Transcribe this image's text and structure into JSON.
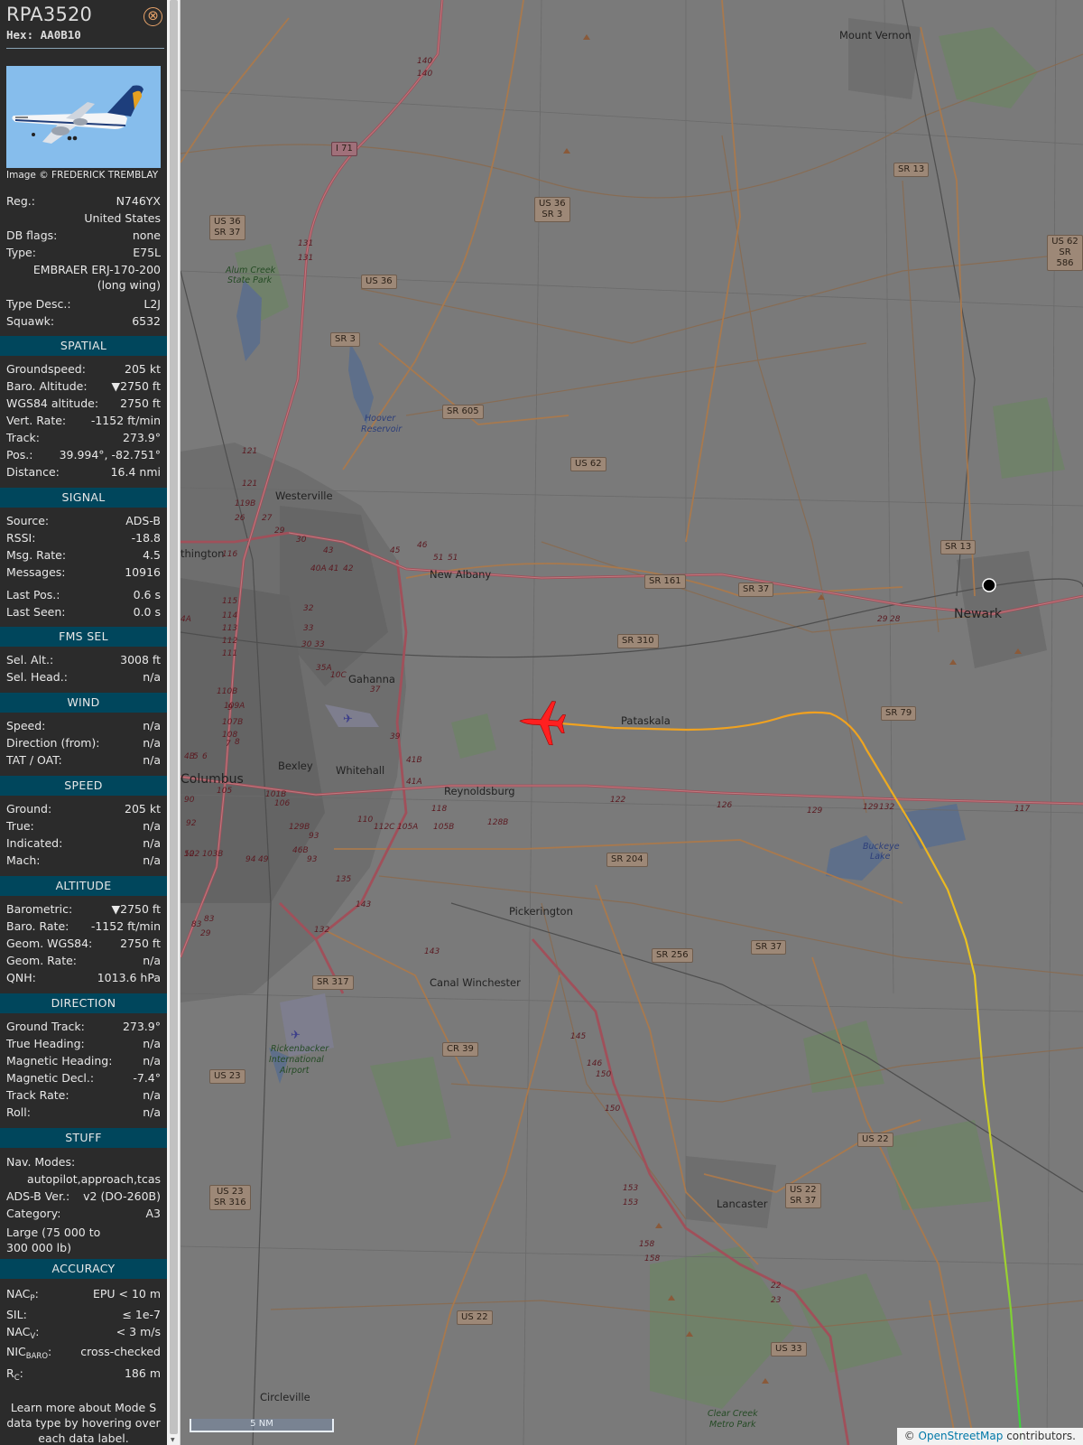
{
  "header": {
    "callsign": "RPA3520",
    "hex_label": "Hex:",
    "hex": "AA0B10",
    "close_symbol": "⊗"
  },
  "photo": {
    "credit": "Image © FREDERICK TREMBLAY"
  },
  "aircraft": {
    "reg_label": "Reg.:",
    "reg": "N746YX",
    "country": "United States",
    "dbflags_label": "DB flags:",
    "dbflags": "none",
    "type_label": "Type:",
    "type": "E75L",
    "type_full": "EMBRAER ERJ-170-200 (long wing)",
    "typedesc_label": "Type Desc.:",
    "typedesc": "L2J",
    "squawk_label": "Squawk:",
    "squawk": "6532"
  },
  "spatial": {
    "title": "SPATIAL",
    "groundspeed_label": "Groundspeed:",
    "groundspeed": "205 kt",
    "baro_alt_label": "Baro. Altitude:",
    "baro_alt": "▼2750 ft",
    "wgs84_label": "WGS84 altitude:",
    "wgs84": "2750 ft",
    "vert_rate_label": "Vert. Rate:",
    "vert_rate": "-1152 ft/min",
    "track_label": "Track:",
    "track": "273.9°",
    "pos_label": "Pos.:",
    "pos": "39.994°, -82.751°",
    "distance_label": "Distance:",
    "distance": "16.4 nmi"
  },
  "signal": {
    "title": "SIGNAL",
    "source_label": "Source:",
    "source": "ADS-B",
    "rssi_label": "RSSI:",
    "rssi": "-18.8",
    "msgrate_label": "Msg. Rate:",
    "msgrate": "4.5",
    "messages_label": "Messages:",
    "messages": "10916",
    "lastpos_label": "Last Pos.:",
    "lastpos": "0.6 s",
    "lastseen_label": "Last Seen:",
    "lastseen": "0.0 s"
  },
  "fms": {
    "title": "FMS SEL",
    "selalt_label": "Sel. Alt.:",
    "selalt": "3008 ft",
    "selhead_label": "Sel. Head.:",
    "selhead": "n/a"
  },
  "wind": {
    "title": "WIND",
    "speed_label": "Speed:",
    "speed": "n/a",
    "dir_label": "Direction (from):",
    "dir": "n/a",
    "tat_label": "TAT / OAT:",
    "tat": "n/a"
  },
  "speed": {
    "title": "SPEED",
    "ground_label": "Ground:",
    "ground": "205 kt",
    "true_label": "True:",
    "true": "n/a",
    "indicated_label": "Indicated:",
    "indicated": "n/a",
    "mach_label": "Mach:",
    "mach": "n/a"
  },
  "altitude": {
    "title": "ALTITUDE",
    "baro_label": "Barometric:",
    "baro": "▼2750 ft",
    "barorate_label": "Baro. Rate:",
    "barorate": "-1152 ft/min",
    "geom_label": "Geom. WGS84:",
    "geom": "2750 ft",
    "geomrate_label": "Geom. Rate:",
    "geomrate": "n/a",
    "qnh_label": "QNH:",
    "qnh": "1013.6 hPa"
  },
  "direction": {
    "title": "DIRECTION",
    "gtrack_label": "Ground Track:",
    "gtrack": "273.9°",
    "thead_label": "True Heading:",
    "thead": "n/a",
    "mhead_label": "Magnetic Heading:",
    "mhead": "n/a",
    "mdecl_label": "Magnetic Decl.:",
    "mdecl": "-7.4°",
    "trate_label": "Track Rate:",
    "trate": "n/a",
    "roll_label": "Roll:",
    "roll": "n/a"
  },
  "stuff": {
    "title": "STUFF",
    "navmodes_label": "Nav. Modes:",
    "navmodes": "autopilot,approach,tcas",
    "adsbver_label": "ADS-B Ver.:",
    "adsbver": "v2 (DO-260B)",
    "category_label": "Category:",
    "category": "A3",
    "category_desc": "Large (75 000 to 300 000 lb)"
  },
  "accuracy": {
    "title": "ACCURACY",
    "nacp_label": "NAC",
    "nacp_sub": "P",
    "nacp": "EPU < 10 m",
    "sil_label": "SIL:",
    "sil": "≤ 1e-7",
    "nacv_label": "NAC",
    "nacv_sub": "V",
    "nacv": "< 3 m/s",
    "nicbaro_label": "NIC",
    "nicbaro_sub": "BARO",
    "nicbaro": "cross-checked",
    "rc_label": "R",
    "rc_sub": "C",
    "rc": "186 m",
    "colon": ":",
    "note": "Learn more about Mode S data type by hovering over each data label."
  },
  "map": {
    "places": {
      "mount_vernon": "Mount Vernon",
      "newark": "Newark",
      "westerville": "Westerville",
      "new_albany": "New Albany",
      "gahanna": "Gahanna",
      "bexley": "Bexley",
      "whitehall": "Whitehall",
      "columbus": "Columbus",
      "reynoldsburg": "Reynoldsburg",
      "pataskala": "Pataskala",
      "pickerington": "Pickerington",
      "canal_winchester": "Canal Winchester",
      "lancaster": "Lancaster",
      "circleville": "Circleville",
      "worthington": "thington"
    },
    "parks": {
      "alum_creek_1": "Alum Creek",
      "alum_creek_2": "State Park",
      "clear_creek_1": "Clear Creek",
      "clear_creek_2": "Metro Park",
      "rickenbacker_1": "Rickenbacker",
      "rickenbacker_2": "International",
      "rickenbacker_3": "Airport"
    },
    "water": {
      "hoover_1": "Hoover",
      "hoover_2": "Reservoir",
      "buckeye_1": "Buckeye",
      "buckeye_2": "Lake"
    },
    "shields": {
      "i71": "I 71",
      "us36_sr37": "US 36\nSR 37",
      "us36_sr3": "US 36\nSR 3",
      "us36": "US 36",
      "sr3": "SR 3",
      "sr605": "SR 605",
      "us62": "US 62",
      "sr13_top": "SR 13",
      "us62_sr586": "US 62\nSR 586",
      "sr13": "SR 13",
      "sr161": "SR 161",
      "sr37": "SR 37",
      "sr310": "SR 310",
      "sr79": "SR 79",
      "sr204": "SR 204",
      "sr37_b": "SR 37",
      "sr256": "SR 256",
      "sr317": "SR 317",
      "cr39": "CR 39",
      "us23": "US 23",
      "us22": "US 22",
      "us23_sr316": "US 23\nSR 316",
      "us22_sr37": "US 22\nSR 37",
      "us22_b": "US 22",
      "us33": "US 33"
    },
    "exits": [
      "140",
      "140",
      "131",
      "131",
      "121",
      "121",
      "119B",
      "26",
      "27",
      "29",
      "30",
      "43",
      "45",
      "46",
      "51",
      "51",
      "40A",
      "41",
      "42",
      "32",
      "33",
      "30 33",
      "35A",
      "10C",
      "37",
      "39",
      "41B",
      "41A",
      "118",
      "122",
      "126",
      "129",
      "129",
      "132",
      "117",
      "116",
      "115",
      "114",
      "113",
      "112",
      "111",
      "110B",
      "109A",
      "107B",
      "108",
      "110",
      "112C",
      "105A",
      "105B",
      "128B",
      "129B",
      "93",
      "93",
      "94",
      "49",
      "46B",
      "132",
      "135",
      "143",
      "143",
      "145",
      "146",
      "150",
      "150",
      "153",
      "153",
      "158",
      "158",
      "22",
      "23",
      "102",
      "103B",
      "101B",
      "106",
      "105",
      "90",
      "92",
      "52",
      "83",
      "83",
      "29",
      "29",
      "28",
      "4A",
      "4B",
      "5",
      "6",
      "7",
      "8",
      "9"
    ],
    "scale": "5 NM",
    "attribution_copy": "©",
    "attribution_link": "OpenStreetMap",
    "attribution_rest": "contributors."
  },
  "colors": {
    "sidebar_bg": "#2b2b2b",
    "section_bg": "#00465c",
    "close_accent": "#e8a36a",
    "aircraft": "#ff2020",
    "trail_orange": "#f0a020",
    "trail_yellow": "#e6d020",
    "trail_green": "#40d040",
    "road": "#a0505a"
  },
  "icons": {
    "close": "close-icon",
    "aircraft": "aircraft-icon",
    "receiver": "receiver-location-icon"
  }
}
